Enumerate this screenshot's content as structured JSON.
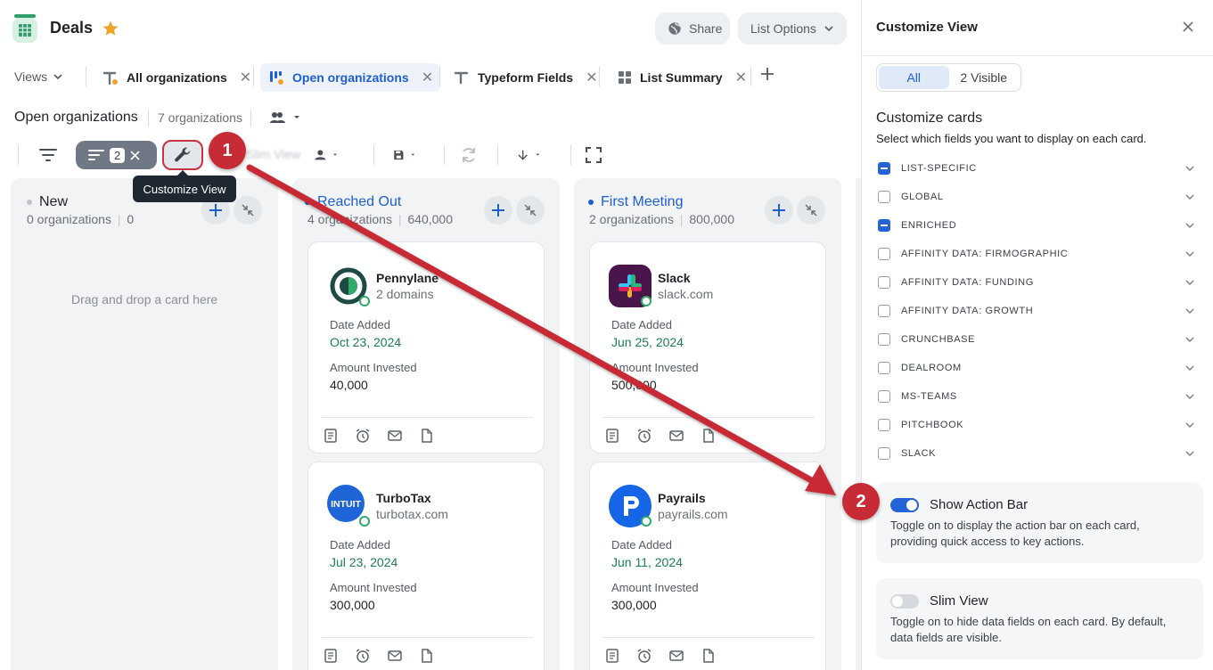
{
  "header": {
    "title": "Deals",
    "share_label": "Share",
    "list_options_label": "List Options"
  },
  "tabs": {
    "views_label": "Views",
    "items": [
      {
        "label": "All organizations"
      },
      {
        "label": "Open organizations"
      },
      {
        "label": "Typeform Fields"
      },
      {
        "label": "List Summary"
      }
    ]
  },
  "list": {
    "title": "Open organizations",
    "count": "7 organizations"
  },
  "toolbar": {
    "sort_count": "2",
    "tooltip": "Customize View",
    "slim_view_ghost": "Slim View"
  },
  "annotations": {
    "step1": "1",
    "step2": "2"
  },
  "columns": [
    {
      "name": "New",
      "count": "0 organizations",
      "amount": "0",
      "empty_message": "Drag and drop a card here"
    },
    {
      "name": "Reached Out",
      "count": "4 organizations",
      "amount": "640,000",
      "cards": [
        {
          "name": "Pennylane",
          "sub": "2 domains",
          "date_label": "Date Added",
          "date": "Oct 23, 2024",
          "amount_label": "Amount Invested",
          "amount": "40,000"
        },
        {
          "name": "TurboTax",
          "sub": "turbotax.com",
          "date_label": "Date Added",
          "date": "Jul 23, 2024",
          "amount_label": "Amount Invested",
          "amount": "300,000"
        }
      ]
    },
    {
      "name": "First Meeting",
      "count": "2 organizations",
      "amount": "800,000",
      "cards": [
        {
          "name": "Slack",
          "sub": "slack.com",
          "date_label": "Date Added",
          "date": "Jun 25, 2024",
          "amount_label": "Amount Invested",
          "amount": "500,000"
        },
        {
          "name": "Payrails",
          "sub": "payrails.com",
          "date_label": "Date Added",
          "date": "Jun 11, 2024",
          "amount_label": "Amount Invested",
          "amount": "300,000"
        }
      ]
    }
  ],
  "panel": {
    "title": "Customize View",
    "seg_all": "All",
    "seg_visible": "2 Visible",
    "cards_title": "Customize cards",
    "cards_sub": "Select which fields you want to display on each card.",
    "fields": [
      {
        "label": "LIST-SPECIFIC",
        "state": "partial"
      },
      {
        "label": "GLOBAL",
        "state": "off"
      },
      {
        "label": "ENRICHED",
        "state": "partial"
      },
      {
        "label": "AFFINITY DATA: FIRMOGRAPHIC",
        "state": "off"
      },
      {
        "label": "AFFINITY DATA: FUNDING",
        "state": "off"
      },
      {
        "label": "AFFINITY DATA: GROWTH",
        "state": "off"
      },
      {
        "label": "CRUNCHBASE",
        "state": "off"
      },
      {
        "label": "DEALROOM",
        "state": "off"
      },
      {
        "label": "MS-TEAMS",
        "state": "off"
      },
      {
        "label": "PITCHBOOK",
        "state": "off"
      },
      {
        "label": "SLACK",
        "state": "off"
      }
    ],
    "action_bar": {
      "title": "Show Action Bar",
      "desc": "Toggle on to display the action bar on each card, providing quick access to key actions.",
      "enabled": true
    },
    "slim_view": {
      "title": "Slim View",
      "desc": "Toggle on to hide data fields on each card. By default, data fields are visible.",
      "enabled": false
    }
  },
  "colors": {
    "accent": "#2563d9",
    "date_green": "#1b7f4f",
    "annotation_red": "#c72b36"
  }
}
